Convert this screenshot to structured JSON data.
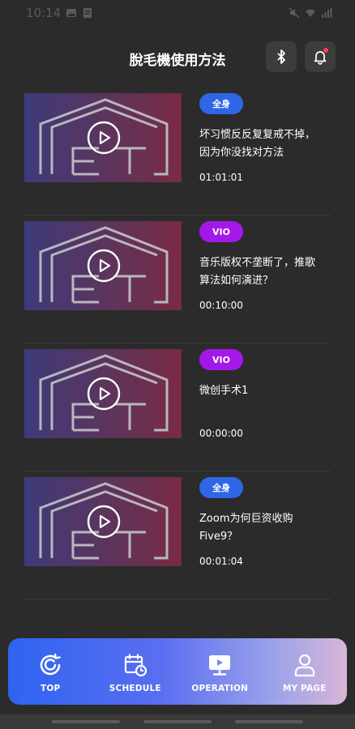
{
  "status_bar": {
    "time": "10:14"
  },
  "header": {
    "title": "脫毛機使用方法"
  },
  "videos": [
    {
      "tag": "全身",
      "tag_color": "#2f66e8",
      "title": "坏习惯反反复复戒不掉，因为你没找对方法",
      "duration": "01:01:01"
    },
    {
      "tag": "VIO",
      "tag_color": "#a318e8",
      "title": "音乐版权不垄断了，推歌算法如何演进？",
      "duration": "00:10:00"
    },
    {
      "tag": "VIO",
      "tag_color": "#a318e8",
      "title": "微创手术1",
      "duration": "00:00:00"
    },
    {
      "tag": "全身",
      "tag_color": "#2f66e8",
      "title": "Zoom为何巨资收购Five9？",
      "duration": "00:01:04"
    }
  ],
  "bottom_nav": {
    "items": [
      {
        "label": "TOP",
        "icon": "refresh-icon"
      },
      {
        "label": "SCHEDULE",
        "icon": "calendar-clock-icon"
      },
      {
        "label": "OPERATION",
        "icon": "video-screen-icon"
      },
      {
        "label": "MY PAGE",
        "icon": "user-icon"
      }
    ]
  },
  "colors": {
    "background": "#2b2b2b",
    "tag_blue": "#2f66e8",
    "tag_purple": "#a318e8",
    "notification_dot": "#ff3b5c"
  }
}
